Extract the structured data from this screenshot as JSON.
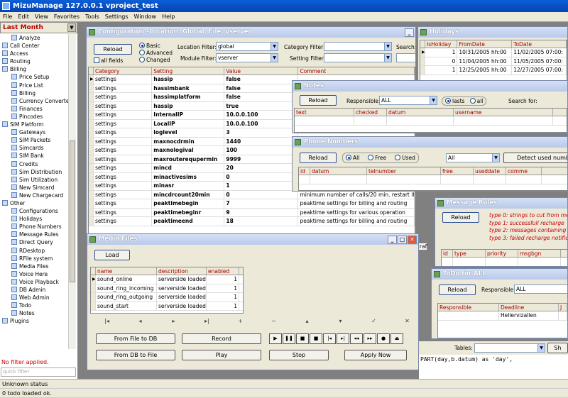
{
  "app": {
    "title": "MizuManage 127.0.0.1 vproject_test"
  },
  "menu": [
    "File",
    "Edit",
    "View",
    "Favorites",
    "Tools",
    "Settings",
    "Window",
    "Help"
  ],
  "sidebar": {
    "period": "Last Month",
    "items": [
      {
        "label": "Analyze",
        "level": 1
      },
      {
        "label": "Call Center",
        "level": 0
      },
      {
        "label": "Access",
        "level": 0
      },
      {
        "label": "Routing",
        "level": 0
      },
      {
        "label": "Billing",
        "level": 0
      },
      {
        "label": "Price Setup",
        "level": 1
      },
      {
        "label": "Price List",
        "level": 1
      },
      {
        "label": "Billing",
        "level": 1
      },
      {
        "label": "Currency Converter",
        "level": 1
      },
      {
        "label": "Finances",
        "level": 1
      },
      {
        "label": "Pincodes",
        "level": 1
      },
      {
        "label": "SIM Platform",
        "level": 0
      },
      {
        "label": "Gateways",
        "level": 1
      },
      {
        "label": "SIM Packets",
        "level": 1
      },
      {
        "label": "Simcards",
        "level": 1
      },
      {
        "label": "SIM Bank",
        "level": 1
      },
      {
        "label": "Credits",
        "level": 1
      },
      {
        "label": "Sim Distribution",
        "level": 1
      },
      {
        "label": "Sim Utilization",
        "level": 1
      },
      {
        "label": "New Simcard",
        "level": 1
      },
      {
        "label": "New Chargecard",
        "level": 1
      },
      {
        "label": "Other",
        "level": 0
      },
      {
        "label": "Configurations",
        "level": 1
      },
      {
        "label": "Holidays",
        "level": 1
      },
      {
        "label": "Phone Numbers",
        "level": 1
      },
      {
        "label": "Message Rules",
        "level": 1
      },
      {
        "label": "Direct Query",
        "level": 1
      },
      {
        "label": "RDesktop",
        "level": 1
      },
      {
        "label": "RFile system",
        "level": 1
      },
      {
        "label": "Media Files",
        "level": 1
      },
      {
        "label": "Voice Here",
        "level": 1
      },
      {
        "label": "Voice Playback",
        "level": 1
      },
      {
        "label": "DB Admin",
        "level": 1
      },
      {
        "label": "Web Admin",
        "level": 1
      },
      {
        "label": "Todo",
        "level": 1
      },
      {
        "label": "Notes",
        "level": 1
      },
      {
        "label": "Plugins",
        "level": 0
      }
    ],
    "no_filter": "No filter applied.",
    "quick_filter_placeholder": "quick filter"
  },
  "status": {
    "line1": "Unknown status",
    "line2": "0 todo loaded ok."
  },
  "config": {
    "title": "Configuration -Location: Global, File: vserver",
    "reload": "Reload",
    "all_fields": "all fields",
    "modes": [
      "Basic",
      "Advanced",
      "Changed"
    ],
    "location_filter_label": "Location Filter:",
    "location_filter": "global",
    "module_filter_label": "Module Filter:",
    "module_filter": "vserver",
    "category_filter_label": "Category Filter:",
    "setting_filter_label": "Setting Filter:",
    "search_label": "Search:",
    "columns": [
      "Category",
      "Setting",
      "Value",
      "Comment"
    ],
    "rows": [
      [
        "settings",
        "hassip",
        "false",
        ""
      ],
      [
        "settings",
        "hassimbank",
        "false",
        ""
      ],
      [
        "settings",
        "hassimplatform",
        "false",
        ""
      ],
      [
        "settings",
        "hassip",
        "true",
        ""
      ],
      [
        "settings",
        "InternalIP",
        "10.0.0.100",
        ""
      ],
      [
        "settings",
        "LocalIP",
        "10.0.0.100",
        ""
      ],
      [
        "settings",
        "loglevel",
        "3",
        ""
      ],
      [
        "settings",
        "maxnocdrmin",
        "1440",
        ""
      ],
      [
        "settings",
        "maxnologival",
        "100",
        ""
      ],
      [
        "settings",
        "maxrouterequpermin",
        "9999",
        ""
      ],
      [
        "settings",
        "mincd",
        "20",
        ""
      ],
      [
        "settings",
        "minactivesims",
        "0",
        ""
      ],
      [
        "settings",
        "minasr",
        "1",
        ""
      ],
      [
        "settings",
        "mincdrcount20min",
        "0",
        "minimum number of calls/20 min. restart if lower"
      ],
      [
        "settings",
        "peaktimebegin",
        "7",
        "peaktime settings for billing and routing"
      ],
      [
        "settings",
        "peaktimebeginr",
        "9",
        "peaktime settings for various operation"
      ],
      [
        "settings",
        "peaktimeend",
        "18",
        "peaktime settings for billing and routing"
      ]
    ]
  },
  "holidays": {
    "title": "Holidays",
    "columns": [
      "IsHoliday",
      "FromDate",
      "ToDate"
    ],
    "rows": [
      [
        "1",
        "10/31/2005 hh:00",
        "11/02/2005 07:00:"
      ],
      [
        "0",
        "11/04/2005 hh:00",
        "11/05/2005 07:00:"
      ],
      [
        "1",
        "12/25/2005 hh:00",
        "12/27/2005 07:00:"
      ]
    ]
  },
  "notes": {
    "title": "Notes",
    "reload": "Reload",
    "responsible_label": "Responsible:",
    "responsible": "ALL",
    "radio": [
      "lasts",
      "all"
    ],
    "search_label": "Search for:",
    "columns": [
      "text",
      "checked",
      "datum",
      "username"
    ]
  },
  "phone": {
    "title": "Phone Numbers",
    "reload": "Reload",
    "radio": [
      "All",
      "Free",
      "Used"
    ],
    "select": "All",
    "detect": "Detect used numb",
    "columns": [
      "id",
      "datum",
      "telnumber",
      "free",
      "useddate",
      "comme"
    ]
  },
  "msgrules": {
    "title": "Message Rules",
    "reload": "Reload",
    "types": [
      "type 0: strings to cut from me",
      "type 1: successfull recharge",
      "type 2: messages containing",
      "type 3: failed recharge notific"
    ],
    "columns": [
      "id",
      "type",
      "priority",
      "msgbgn"
    ]
  },
  "todo": {
    "title": "ToDo for ALL",
    "reload": "Reload",
    "responsible_label": "Responsible:",
    "responsible": "ALL",
    "columns": [
      "Responsible",
      "Deadline",
      "J"
    ],
    "rows": [
      [
        "",
        "Hellervizallen",
        ""
      ]
    ]
  },
  "media": {
    "title": "Media Files",
    "load": "Load",
    "columns": [
      "name",
      "description",
      "enabled"
    ],
    "rows": [
      [
        "sound_online",
        "serverside loaded",
        "1"
      ],
      [
        "sound_ring_incoming",
        "serverside loaded",
        "1"
      ],
      [
        "sound_ring_outgoing",
        "serverside loaded",
        "1"
      ],
      [
        "sound_start",
        "serverside loaded",
        "1"
      ]
    ],
    "nav": [
      "|◂",
      "◂",
      "▸",
      "▸|",
      "+",
      "−",
      "▴",
      "▾",
      "✓",
      "✕",
      "↻"
    ],
    "from_file_to_db": "From File to DB",
    "from_db_to_file": "From DB to File",
    "record": "Record",
    "play": "Play",
    "stop": "Stop",
    "apply_now": "Apply Now",
    "controls": [
      "▶",
      "❚❚",
      "■",
      "■",
      "|◂",
      "▸|",
      "◂◂",
      "▸▸",
      "●",
      "⏏"
    ]
  },
  "query": {
    "tables_label": "Tables:",
    "show": "Sh",
    "code": "PART(day,b.datum) as 'day',",
    "fragment": "traf"
  }
}
